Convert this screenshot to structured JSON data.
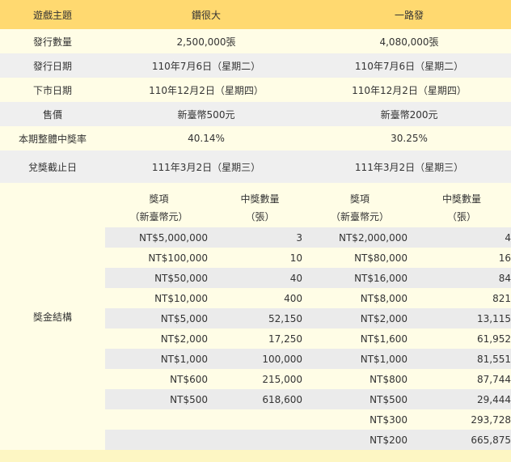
{
  "header": {
    "label": "遊戲主題",
    "game1": "鑽很大",
    "game2": "一路發"
  },
  "rows": [
    {
      "label": "發行數量",
      "v1": "2,500,000張",
      "v2": "4,080,000張"
    },
    {
      "label": "發行日期",
      "v1": "110年7月6日（星期二）",
      "v2": "110年7月6日（星期二）"
    },
    {
      "label": "下市日期",
      "v1": "110年12月2日（星期四）",
      "v2": "110年12月2日（星期四）"
    },
    {
      "label": "售價",
      "v1": "新臺幣500元",
      "v2": "新臺幣200元"
    },
    {
      "label": "本期整體中獎率",
      "v1": "40.14%",
      "v2": "30.25%"
    },
    {
      "label": "兌獎截止日",
      "v1": "111年3月2日（星期三）",
      "v2": "111年3月2日（星期三）"
    }
  ],
  "prize": {
    "label": "獎金結構",
    "col_prize": "獎項",
    "col_prize_unit": "（新臺幣元）",
    "col_count": "中獎數量",
    "col_count_unit": "（張）",
    "rows": [
      {
        "p1": "NT$5,000,000",
        "c1": "3",
        "p2": "NT$2,000,000",
        "c2": "4"
      },
      {
        "p1": "NT$100,000",
        "c1": "10",
        "p2": "NT$80,000",
        "c2": "16"
      },
      {
        "p1": "NT$50,000",
        "c1": "40",
        "p2": "NT$16,000",
        "c2": "84"
      },
      {
        "p1": "NT$10,000",
        "c1": "400",
        "p2": "NT$8,000",
        "c2": "821"
      },
      {
        "p1": "NT$5,000",
        "c1": "52,150",
        "p2": "NT$2,000",
        "c2": "13,115"
      },
      {
        "p1": "NT$2,000",
        "c1": "17,250",
        "p2": "NT$1,600",
        "c2": "61,952"
      },
      {
        "p1": "NT$1,000",
        "c1": "100,000",
        "p2": "NT$1,000",
        "c2": "81,551"
      },
      {
        "p1": "NT$600",
        "c1": "215,000",
        "p2": "NT$800",
        "c2": "87,744"
      },
      {
        "p1": "NT$500",
        "c1": "618,600",
        "p2": "NT$500",
        "c2": "29,444"
      },
      {
        "p1": "",
        "c1": "",
        "p2": "NT$300",
        "c2": "293,728"
      },
      {
        "p1": "",
        "c1": "",
        "p2": "NT$200",
        "c2": "665,875"
      }
    ]
  },
  "colors": {
    "header": "#ffd970",
    "band_light": "#fffde6",
    "band_gray": "#efefef",
    "background": "#fdf6c3"
  }
}
